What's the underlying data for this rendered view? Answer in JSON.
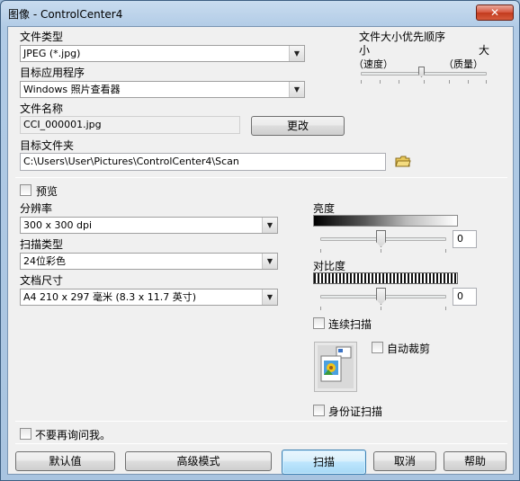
{
  "window": {
    "title": "图像 - ControlCenter4",
    "close_symbol": "✕"
  },
  "file_type": {
    "label": "文件类型",
    "value": "JPEG (*.jpg)"
  },
  "target_app": {
    "label": "目标应用程序",
    "value": "Windows 照片查看器"
  },
  "file_name": {
    "label": "文件名称",
    "value": "CCI_000001.jpg",
    "change_button": "更改"
  },
  "target_folder": {
    "label": "目标文件夹",
    "value": "C:\\Users\\User\\Pictures\\ControlCenter4\\Scan"
  },
  "size_priority": {
    "label": "文件大小优先顺序",
    "small": "小",
    "large": "大",
    "speed": "（速度）",
    "quality": "（质量）"
  },
  "preview": {
    "label": "预览"
  },
  "resolution": {
    "label": "分辨率",
    "value": "300 x 300 dpi"
  },
  "scan_type": {
    "label": "扫描类型",
    "value": "24位彩色"
  },
  "doc_size": {
    "label": "文档尺寸",
    "value": "A4 210 x 297 毫米 (8.3 x 11.7 英寸)"
  },
  "brightness": {
    "label": "亮度",
    "value": "0"
  },
  "contrast": {
    "label": "对比度",
    "value": "0"
  },
  "continuous_scan": {
    "label": "连续扫描"
  },
  "auto_crop": {
    "label": "自动裁剪"
  },
  "id_scan": {
    "label": "身份证扫描"
  },
  "dont_ask": {
    "label": "不要再询问我。"
  },
  "buttons": {
    "default": "默认值",
    "advanced": "高级模式",
    "scan": "扫描",
    "cancel": "取消",
    "help": "帮助"
  }
}
